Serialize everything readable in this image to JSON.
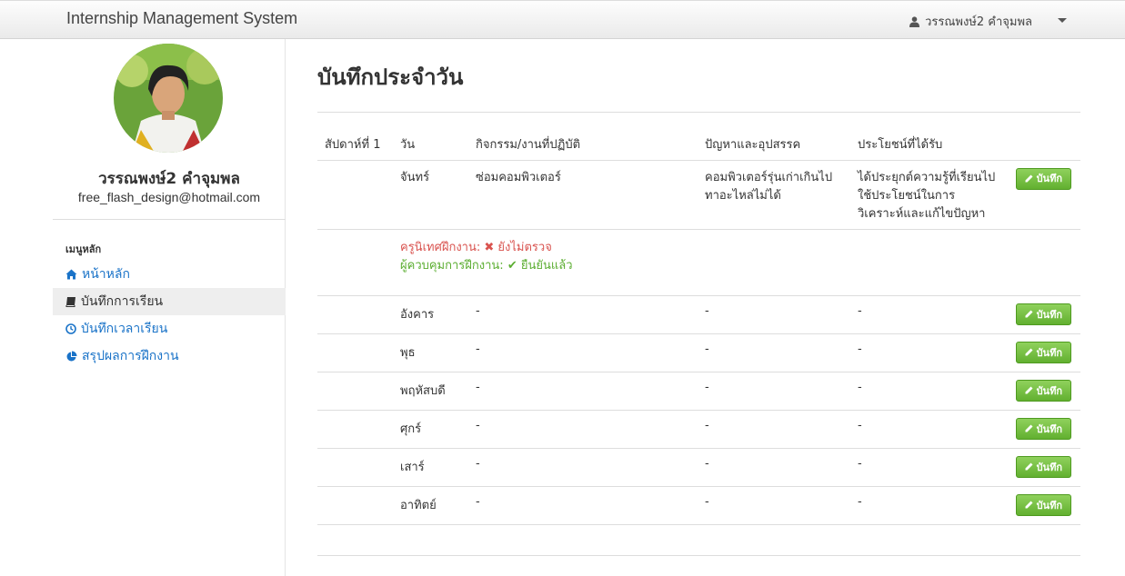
{
  "navbar": {
    "brand": "Internship Management System",
    "user_name": "วรรณพงษ์2 คำจุมพล"
  },
  "profile": {
    "name": "วรรณพงษ์2 คำจุมพล",
    "email": "free_flash_design@hotmail.com"
  },
  "sidebar": {
    "heading": "เมนูหลัก",
    "items": [
      {
        "label": "หน้าหลัก",
        "icon": "home-icon"
      },
      {
        "label": "บันทึกการเรียน",
        "icon": "book-icon"
      },
      {
        "label": "บันทึกเวลาเรียน",
        "icon": "clock-icon"
      },
      {
        "label": "สรุปผลการฝึกงาน",
        "icon": "pie-chart-icon"
      }
    ]
  },
  "main": {
    "title": "บันทึกประจำวัน",
    "table": {
      "headers": [
        "สัปดาห์ที่ 1",
        "วัน",
        "กิจกรรม/งานที่ปฏิบัติ",
        "ปัญหาและอุปสรรค",
        "ประโยชน์ที่ได้รับ"
      ],
      "rows": [
        {
          "day": "จันทร์",
          "activity": "ซ่อมคอมพิวเตอร์",
          "problem": "คอมพิวเตอร์รุ่นเก่าเกินไปทาอะไหล่ไม่ได้",
          "benefit": "ได้ประยุกต์ความรู้ที่เรียนไปใช้ประโยชน์ในการวิเคราะห์และแก้ไขปัญหา"
        },
        {
          "day": "อังคาร",
          "activity": "-",
          "problem": "-",
          "benefit": "-"
        },
        {
          "day": "พุธ",
          "activity": "-",
          "problem": "-",
          "benefit": "-"
        },
        {
          "day": "พฤหัสบดี",
          "activity": "-",
          "problem": "-",
          "benefit": "-"
        },
        {
          "day": "ศุกร์",
          "activity": "-",
          "problem": "-",
          "benefit": "-"
        },
        {
          "day": "เสาร์",
          "activity": "-",
          "problem": "-",
          "benefit": "-"
        },
        {
          "day": "อาทิตย์",
          "activity": "-",
          "problem": "-",
          "benefit": "-"
        }
      ],
      "save_label": "บันทึก",
      "status": {
        "teacher_label": "ครูนิเทศฝึกงาน:",
        "teacher_value": "ยังไม่ตรวจ",
        "supervisor_label": "ผู้ควบคุมการฝึกงาน:",
        "supervisor_value": "ยืนยันแล้ว"
      }
    }
  },
  "colors": {
    "link": "#1a73c8",
    "success": "#62b030",
    "danger": "#d9534f"
  }
}
